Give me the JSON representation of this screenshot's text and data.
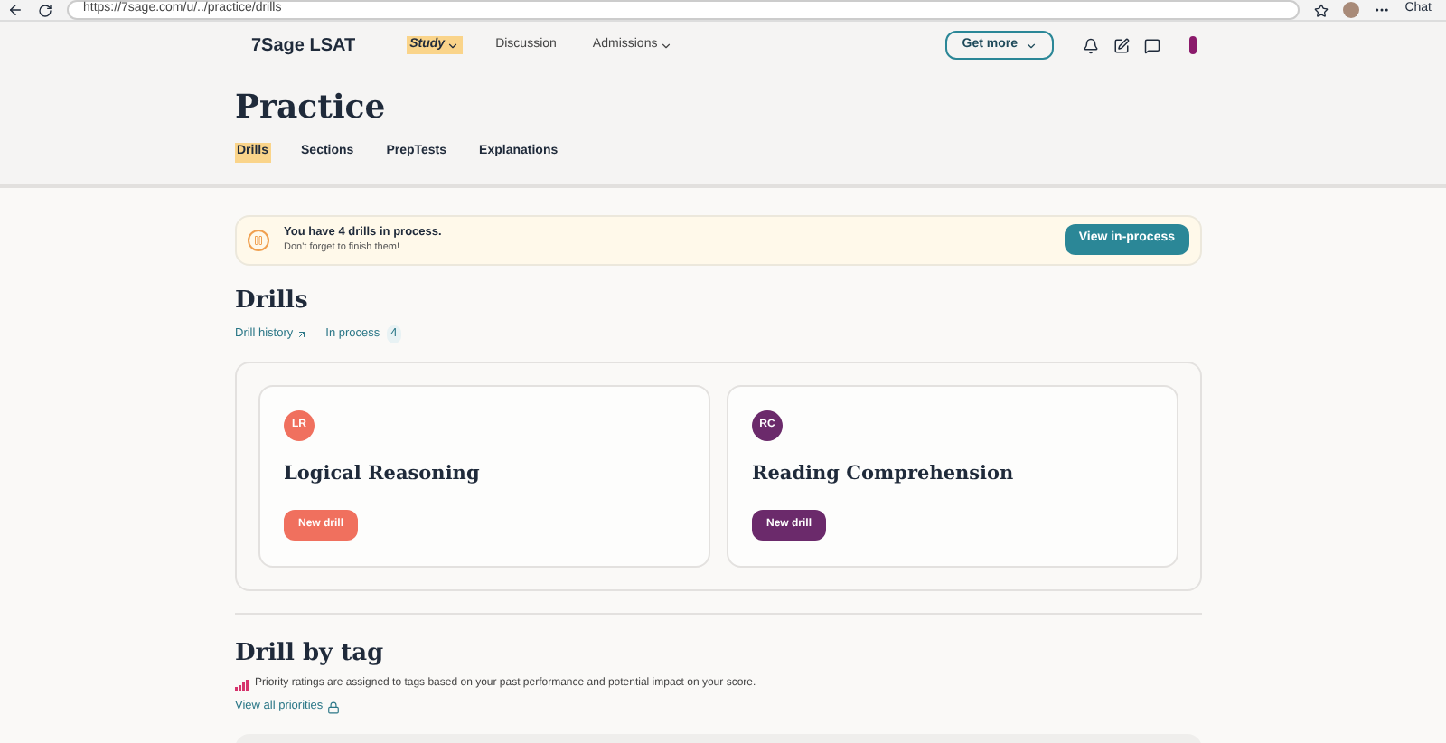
{
  "browser": {
    "url": "https://7sage.com/u/../practice/drills",
    "chat": "Chat"
  },
  "nav": {
    "logo": "7Sage LSAT",
    "items": [
      {
        "label": "Study",
        "selected": true,
        "dropdown": true
      },
      {
        "label": "Discussion",
        "selected": false,
        "dropdown": false
      },
      {
        "label": "Admissions",
        "selected": false,
        "dropdown": true
      }
    ],
    "cta": "Get more"
  },
  "page": {
    "title": "Practice",
    "tabs": [
      {
        "label": "Drills",
        "selected": true
      },
      {
        "label": "Sections",
        "selected": false
      },
      {
        "label": "PrepTests",
        "selected": false
      },
      {
        "label": "Explanations",
        "selected": false
      }
    ]
  },
  "banner": {
    "title": "You have 4 drills in process.",
    "subtitle": "Don't forget to finish them!",
    "button": "View in-process"
  },
  "drills": {
    "title": "Drills",
    "history_link": "Drill history",
    "in_process_link": "In process",
    "in_process_count": "4",
    "cards": [
      {
        "badge": "LR",
        "title": "Logical Reasoning",
        "button": "New drill",
        "color": "#f0705e"
      },
      {
        "badge": "RC",
        "title": "Reading Comprehension",
        "button": "New drill",
        "color": "#6b2a6b"
      }
    ]
  },
  "drill_by_tag": {
    "title": "Drill by tag",
    "note": "Priority ratings are assigned to tags based on your past performance and potential impact on your score.",
    "link": "View all priorities"
  }
}
